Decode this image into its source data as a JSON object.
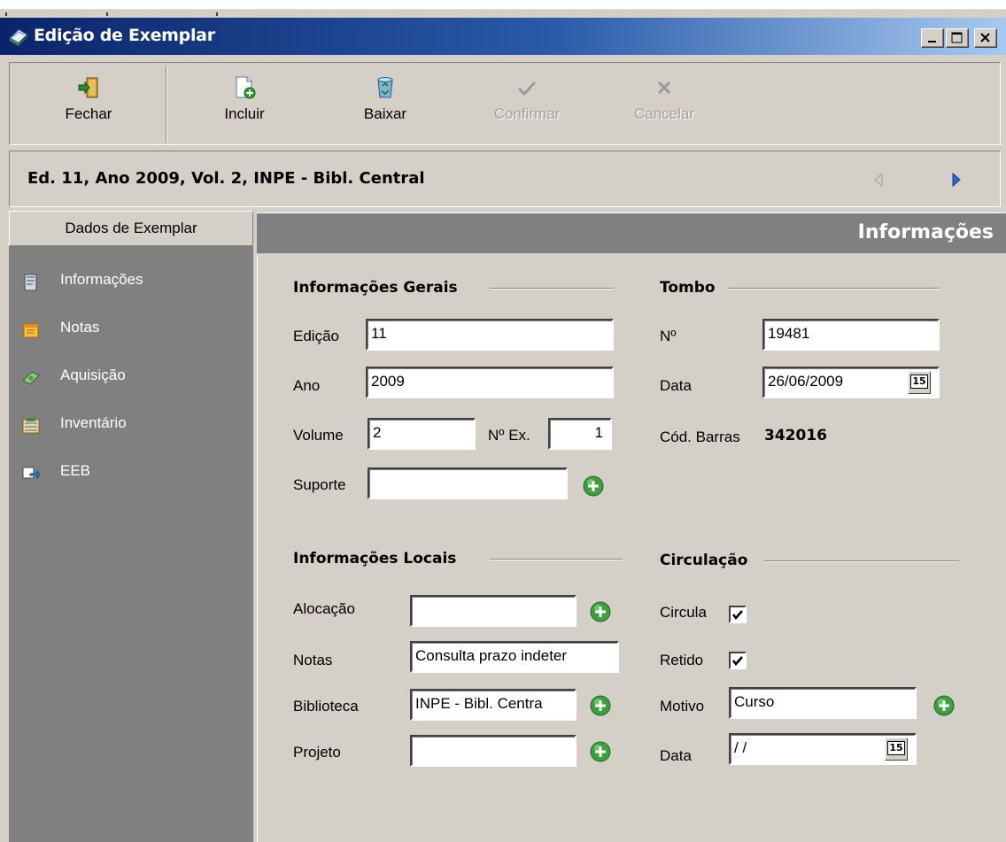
{
  "window": {
    "title": "Edição de Exemplar"
  },
  "toolbar": {
    "fechar": "Fechar",
    "incluir": "Incluir",
    "baixar": "Baixar",
    "confirmar": "Confirmar",
    "cancelar": "Cancelar"
  },
  "record": {
    "title": "Ed. 11, Ano 2009, Vol. 2, INPE - Bibl. Central"
  },
  "sidebar": {
    "header": "Dados de Exemplar",
    "items": [
      {
        "label": "Informações",
        "icon": "document-icon"
      },
      {
        "label": "Notas",
        "icon": "notes-icon"
      },
      {
        "label": "Aquisição",
        "icon": "money-icon"
      },
      {
        "label": "Inventário",
        "icon": "inventory-icon"
      },
      {
        "label": "EEB",
        "icon": "transfer-icon"
      }
    ]
  },
  "content": {
    "title": "Informações"
  },
  "gerais": {
    "title": "Informações Gerais",
    "edicao_label": "Edição",
    "edicao": "11",
    "ano_label": "Ano",
    "ano": "2009",
    "volume_label": "Volume",
    "volume": "2",
    "nex_label": "Nº Ex.",
    "nex": "1",
    "suporte_label": "Suporte",
    "suporte": ""
  },
  "tombo": {
    "title": "Tombo",
    "numero_label": "Nº",
    "numero": "19481",
    "data_label": "Data",
    "data": "26/06/2009",
    "barras_label": "Cód. Barras",
    "barras": "342016"
  },
  "locais": {
    "title": "Informações Locais",
    "alocacao_label": "Alocação",
    "alocacao": "",
    "notas_label": "Notas",
    "notas": "Consulta prazo indeter",
    "biblioteca_label": "Biblioteca",
    "biblioteca": "INPE - Bibl. Centra",
    "projeto_label": "Projeto",
    "projeto": ""
  },
  "circulacao": {
    "title": "Circulação",
    "circula_label": "Circula",
    "circula": true,
    "retido_label": "Retido",
    "retido": true,
    "motivo_label": "Motivo",
    "motivo": "Curso",
    "data_label": "Data",
    "data": " / /"
  },
  "calendar_glyph": "15",
  "colors": {
    "title_start": "#0a246a",
    "title_end": "#a6caf0",
    "panel_gray": "#808080",
    "face": "#d4d0c8",
    "plus_green": "#3ca03c",
    "nav_blue": "#2a6ad8"
  }
}
